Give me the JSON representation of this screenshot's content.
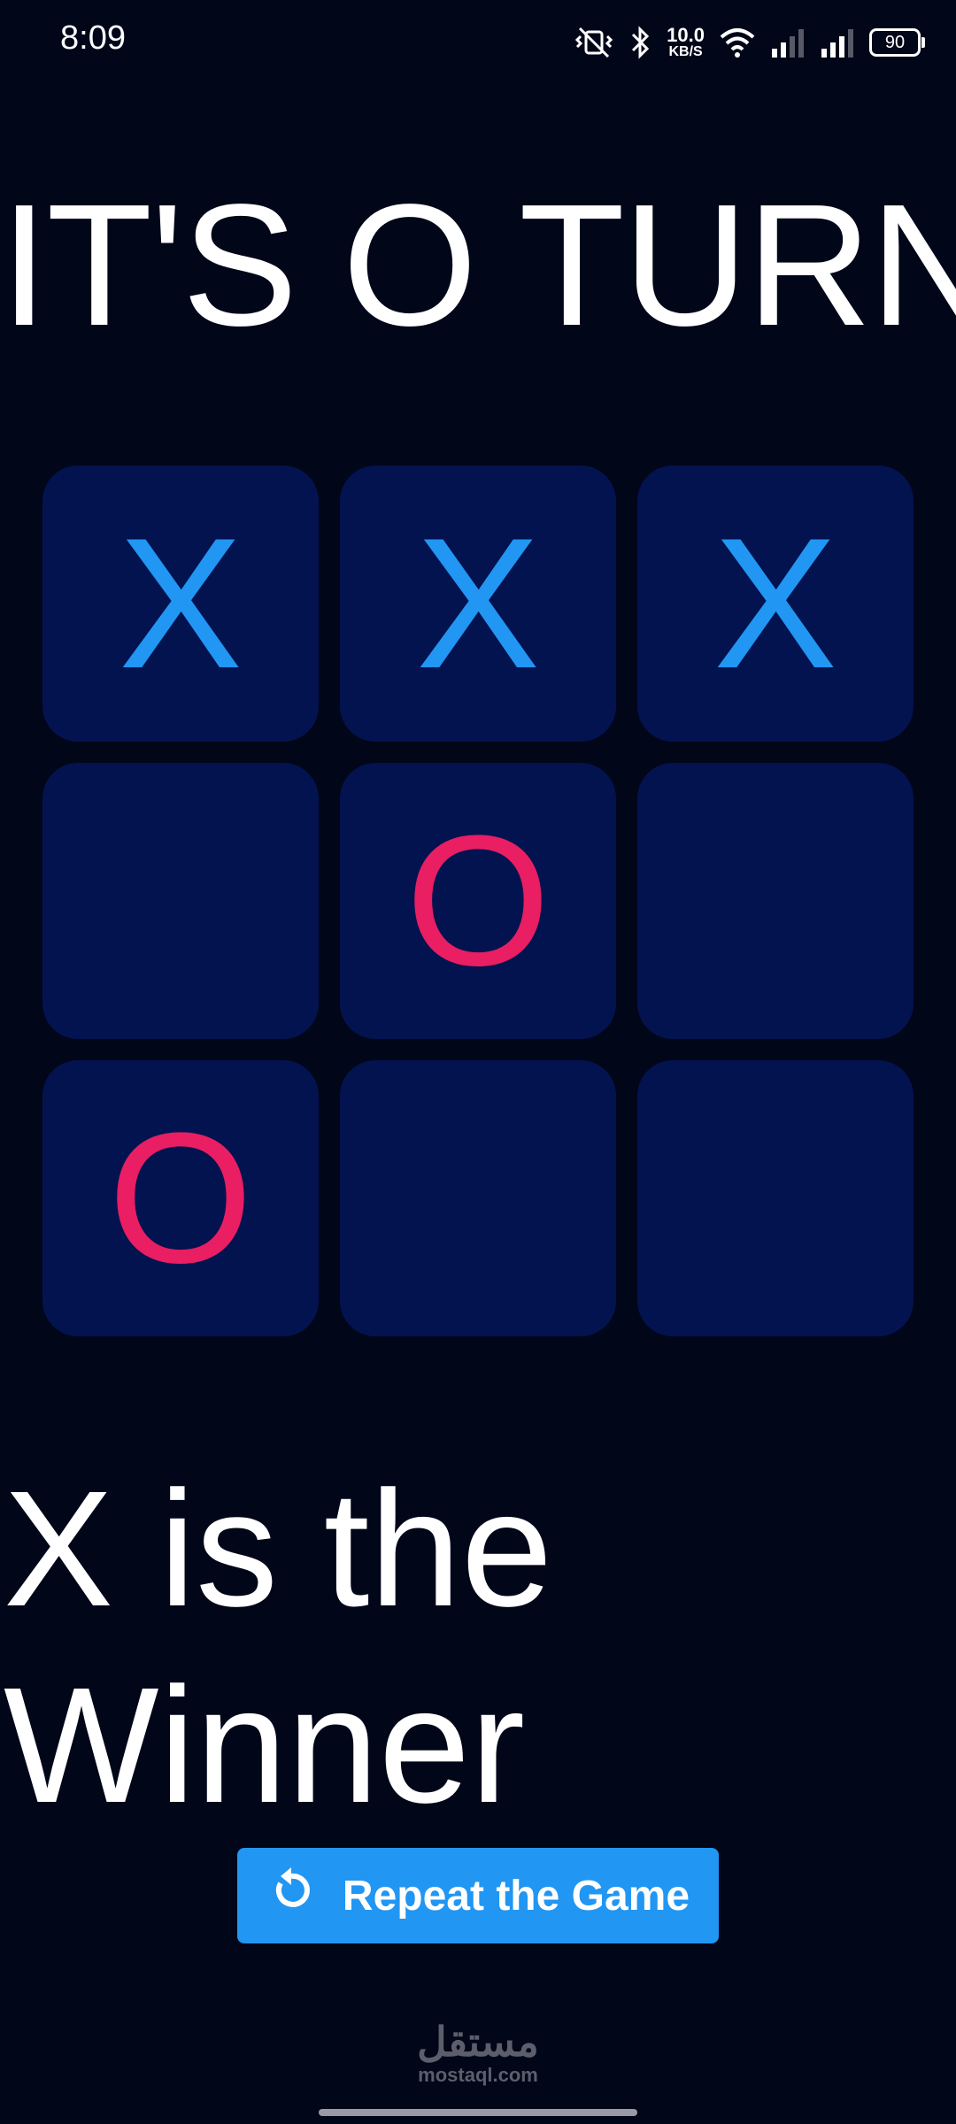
{
  "status_bar": {
    "time": "8:09",
    "net_speed": "10.0",
    "net_unit": "KB/S",
    "battery": "90"
  },
  "game": {
    "turn_text": "IT'S O TURN",
    "board": [
      [
        "X",
        "X",
        "X"
      ],
      [
        "",
        "O",
        ""
      ],
      [
        "O",
        "",
        ""
      ]
    ],
    "winner_text": "X is the Winner",
    "repeat_button_label": "Repeat the Game"
  },
  "watermark": {
    "arabic": "مستقل",
    "latin": "mostaql.com"
  },
  "colors": {
    "background": "#010619",
    "cell": "#03134f",
    "x_mark": "#2196f3",
    "o_mark": "#e91e63",
    "button": "#2196f3"
  }
}
